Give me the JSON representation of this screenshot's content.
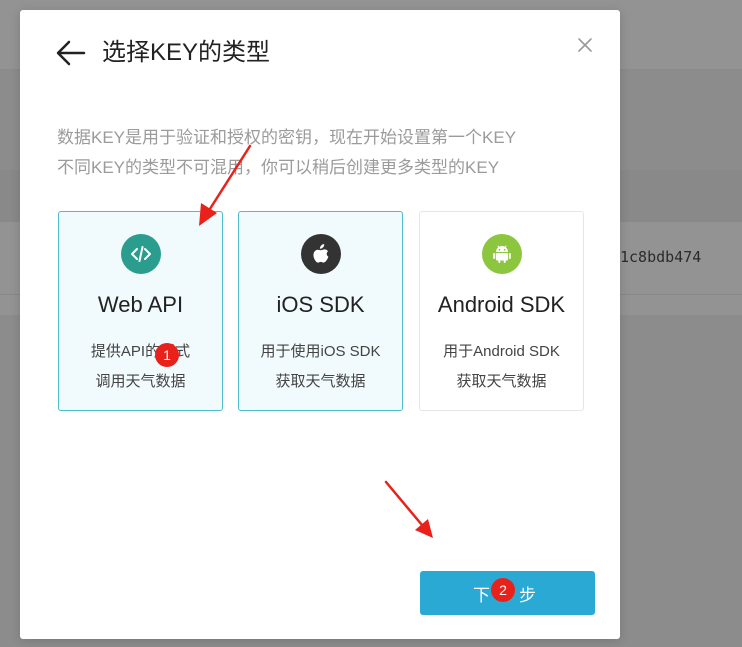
{
  "background": {
    "key_fragment": "1c8bdb474"
  },
  "modal": {
    "title": "选择KEY的类型",
    "description_lines": [
      "数据KEY是用于验证和授权的密钥，现在开始设置第一个KEY",
      "不同KEY的类型不可混用，你可以稍后创建更多类型的KEY"
    ],
    "cards": [
      {
        "id": "web-api",
        "title": "Web API",
        "desc_lines": [
          "提供API的形式",
          "调用天气数据"
        ],
        "icon": "code-icon",
        "icon_color": "#2a9d8f",
        "selected": true
      },
      {
        "id": "ios-sdk",
        "title": "iOS SDK",
        "desc_lines": [
          "用于使用iOS SDK",
          "获取天气数据"
        ],
        "icon": "apple-icon",
        "icon_color": "#333333",
        "selected": true
      },
      {
        "id": "android-sdk",
        "title": "Android SDK",
        "desc_lines": [
          "用于Android SDK",
          "获取天气数据"
        ],
        "icon": "android-icon",
        "icon_color": "#8cc63f",
        "selected": false
      }
    ],
    "next_button": "下一步"
  },
  "annotations": {
    "badge_1": "1",
    "badge_2": "2",
    "accent": "#e8221b"
  },
  "colors": {
    "primary_button": "#2ba9d5",
    "selected_border": "#4fbcc9"
  }
}
